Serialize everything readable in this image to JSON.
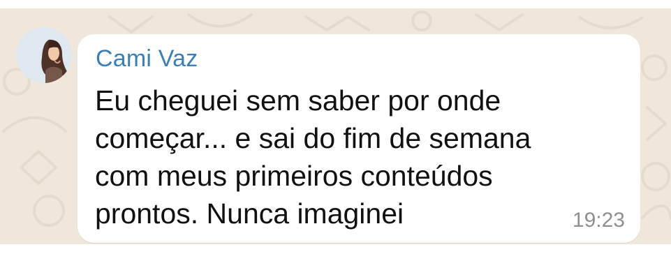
{
  "message": {
    "sender_name": "Cami Vaz",
    "lines": [
      "Eu cheguei sem saber por onde",
      "começar... e sai do fim de semana",
      "com meus primeiros conteúdos",
      "prontos. Nunca imaginei"
    ],
    "time": "19:23",
    "avatar_icon": "profile-photo-icon"
  },
  "colors": {
    "background": "#efe7dc",
    "bubble": "#ffffff",
    "sender_name": "#3e7fb3",
    "message_text": "#111111",
    "timestamp": "#8f8f8f"
  }
}
